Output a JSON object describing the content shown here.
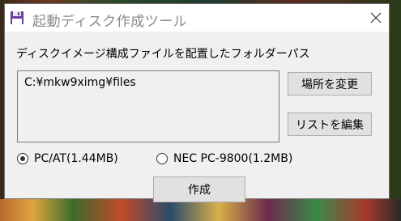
{
  "window": {
    "title": "起動ディスク作成ツール",
    "close_label": "✕"
  },
  "main": {
    "path_label": "ディスクイメージ構成ファイルを配置したフォルダーパス",
    "path_list": [
      "C:¥mkw9ximg¥files"
    ],
    "change_location_button": "場所を変更",
    "edit_list_button": "リストを編集",
    "radio_options": [
      {
        "label": "PC/AT(1.44MB)",
        "selected": true
      },
      {
        "label": "NEC PC-9800(1.2MB)",
        "selected": false
      }
    ],
    "create_button": "作成"
  },
  "colors": {
    "title_text": "#8a8a8a",
    "client_bg": "#f0f0f0",
    "button_bg": "#e1e1e1",
    "icon_accent": "#6b3fa0"
  }
}
